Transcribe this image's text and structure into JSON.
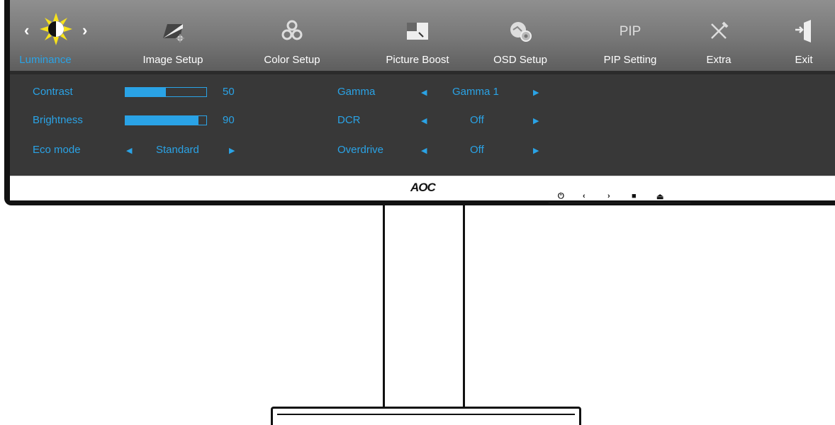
{
  "osd": {
    "tabs": [
      {
        "label": "Luminance",
        "icon": "luminance-sun-icon",
        "active": true
      },
      {
        "label": "Image Setup",
        "icon": "image-setup-icon"
      },
      {
        "label": "Color Setup",
        "icon": "color-setup-icon"
      },
      {
        "label": "Picture Boost",
        "icon": "picture-boost-icon"
      },
      {
        "label": "OSD Setup",
        "icon": "osd-setup-icon"
      },
      {
        "label": "PIP Setting",
        "icon_text": "PIP"
      },
      {
        "label": "Extra",
        "icon": "extra-tools-icon"
      },
      {
        "label": "Exit",
        "icon": "exit-door-icon"
      }
    ],
    "left": {
      "contrast": {
        "label": "Contrast",
        "value": "50",
        "level": 0.5
      },
      "brightness": {
        "label": "Brightness",
        "value": "90",
        "level": 0.9
      },
      "eco": {
        "label": "Eco mode",
        "value": "Standard"
      }
    },
    "right": {
      "gamma": {
        "label": "Gamma",
        "value": "Gamma 1"
      },
      "dcr": {
        "label": "DCR",
        "value": "Off"
      },
      "overdrive": {
        "label": "Overdrive",
        "value": "Off"
      }
    },
    "accent_color": "#2aa3e6"
  },
  "bezel": {
    "logo": "AOC",
    "buttons": [
      "power-icon",
      "left-icon",
      "right-icon",
      "menu-icon",
      "source-icon"
    ]
  }
}
